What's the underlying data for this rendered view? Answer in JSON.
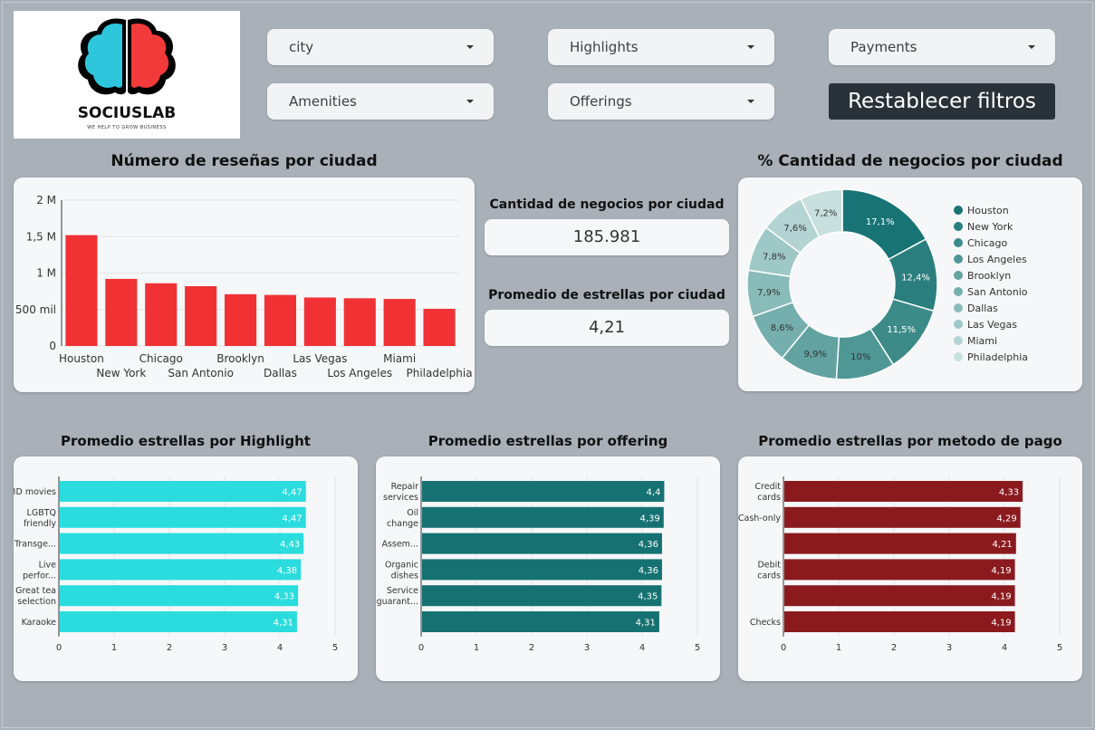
{
  "logo": {
    "brand": "SOCIUSLAB",
    "tagline": "WE HELP TO GROW BUSINESS"
  },
  "filters": {
    "city": "city",
    "highlights": "Highlights",
    "payments": "Payments",
    "amenities": "Amenities",
    "offerings": "Offerings",
    "reset_label": "Restablecer filtros"
  },
  "titles": {
    "reviews": "Número de reseñas por ciudad",
    "pct_business": "% Cantidad de negocios por ciudad",
    "highlight": "Promedio estrellas por Highlight",
    "offering": "Promedio estrellas por offering",
    "payment": "Promedio estrellas por metodo de pago"
  },
  "kpis": {
    "business_label": "Cantidad de negocios por ciudad",
    "business_value": "185.981",
    "stars_label": "Promedio de estrellas por ciudad",
    "stars_value": "4,21"
  },
  "colors": {
    "red_bar": "#f03234",
    "cyan_bar": "#2adcdd",
    "teal_bar": "#167272",
    "darkred_bar": "#8b1a1e"
  },
  "chart_data": [
    {
      "id": "reviews",
      "type": "bar",
      "title": "Número de reseñas por ciudad",
      "categories": [
        "Houston",
        "New York",
        "Chicago",
        "San Antonio",
        "Brooklyn",
        "Dallas",
        "Las Vegas",
        "Los Angeles",
        "Miami",
        "Philadelphia"
      ],
      "values": [
        1520000,
        920000,
        860000,
        820000,
        710000,
        700000,
        665000,
        655000,
        645000,
        510000
      ],
      "yticks": [
        0,
        500000,
        1000000,
        1500000,
        2000000
      ],
      "ytick_labels": [
        "0",
        "500 mil",
        "1 M",
        "1,5 M",
        "2 M"
      ],
      "ylim": [
        0,
        2000000
      ]
    },
    {
      "id": "pct_business",
      "type": "pie",
      "title": "% Cantidad de negocios por ciudad",
      "labels": [
        "Houston",
        "New York",
        "Chicago",
        "Los Angeles",
        "Brooklyn",
        "San Antonio",
        "Dallas",
        "Las Vegas",
        "Miami",
        "Philadelphia"
      ],
      "values": [
        17.1,
        12.4,
        11.5,
        10,
        9.9,
        8.6,
        7.9,
        7.8,
        7.6,
        7.2
      ],
      "value_labels": [
        "17,1%",
        "12,4%",
        "11,5%",
        "10%",
        "9,9%",
        "8,6%",
        "7,9%",
        "7,8%",
        "7,6%",
        "7,2%"
      ],
      "colors": [
        "#187474",
        "#2a7f7e",
        "#3d8b89",
        "#4f9795",
        "#62a3a1",
        "#75afad",
        "#89bcb9",
        "#9ec8c6",
        "#b3d4d2",
        "#c8e0de"
      ],
      "legend": "right"
    },
    {
      "id": "highlight",
      "type": "bar",
      "title": "Promedio estrellas por Highlight",
      "categories": [
        "3D movies",
        "LGBTQ friendly",
        "Transge...",
        "Live perfor...",
        "Great tea selection",
        "Karaoke"
      ],
      "values": [
        4.47,
        4.47,
        4.43,
        4.38,
        4.33,
        4.31
      ],
      "value_labels": [
        "4,47",
        "4,47",
        "4,43",
        "4,38",
        "4,33",
        "4,31"
      ],
      "xticks": [
        0,
        1,
        2,
        3,
        4,
        5
      ],
      "xlim": [
        0,
        5
      ]
    },
    {
      "id": "offering",
      "type": "bar",
      "title": "Promedio estrellas por offering",
      "categories": [
        "Repair services",
        "Oil change",
        "Assem...",
        "Organic dishes",
        "Service guarant...",
        ""
      ],
      "values": [
        4.4,
        4.39,
        4.36,
        4.36,
        4.35,
        4.31
      ],
      "value_labels": [
        "4,4",
        "4,39",
        "4,36",
        "4,36",
        "4,35",
        "4,31"
      ],
      "xticks": [
        0,
        1,
        2,
        3,
        4,
        5
      ],
      "xlim": [
        0,
        5
      ]
    },
    {
      "id": "payment",
      "type": "bar",
      "title": "Promedio estrellas por metodo de pago",
      "categories": [
        "Credit cards",
        "Cash-only",
        "",
        "Debit cards",
        "",
        "Checks"
      ],
      "values": [
        4.33,
        4.29,
        4.21,
        4.19,
        4.19,
        4.19
      ],
      "value_labels": [
        "4,33",
        "4,29",
        "4,21",
        "4,19",
        "4,19",
        "4,19"
      ],
      "xticks": [
        0,
        1,
        2,
        3,
        4,
        5
      ],
      "xlim": [
        0,
        5
      ]
    }
  ]
}
